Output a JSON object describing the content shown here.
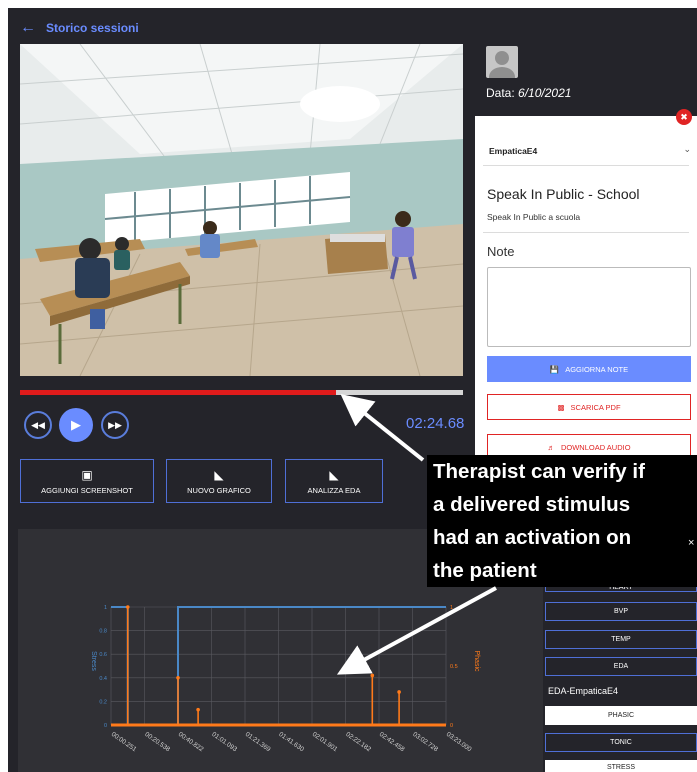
{
  "header": {
    "back_icon": "arrow-left-icon",
    "title": "Storico sessioni"
  },
  "player": {
    "progress_fraction": 0.714,
    "time": "02:24.68",
    "controls": [
      "rewind-icon",
      "play-icon",
      "fast-forward-icon"
    ]
  },
  "actions": [
    {
      "label": "AGGIUNGI SCREENSHOT",
      "icon": "camera-icon"
    },
    {
      "label": "NUOVO GRAFICO",
      "icon": "area-chart-icon"
    },
    {
      "label": "ANALIZZA EDA",
      "icon": "area-chart-icon"
    }
  ],
  "session": {
    "data_label": "Data:",
    "date": "6/10/2021",
    "device": "EmpaticaE4",
    "title": "Speak In Public - School",
    "subtitle": "Speak In Public a scuola",
    "note_label": "Note",
    "note_value": "",
    "buttons": {
      "update": "AGGIORNA NOTE",
      "pdf": "SCARICA PDF",
      "audio": "DOWNLOAD AUDIO"
    }
  },
  "metrics": {
    "buttons": [
      "HEART",
      "BVP",
      "TEMP",
      "EDA"
    ],
    "section_label": "EDA-EmpaticaE4",
    "sub_buttons": [
      "PHASIC",
      "TONIC",
      "STRESS"
    ],
    "active": "PHASIC"
  },
  "callout": {
    "lines": [
      "Therapist can verify if",
      "a delivered stimulus",
      "had an activation on",
      "the patient"
    ],
    "close": "×"
  },
  "colors": {
    "accent": "#6a8cff",
    "stress": "#4a88c7",
    "phasic": "#ff7a1a",
    "danger": "#e02424"
  },
  "chart_data": {
    "type": "line",
    "x_ticks": [
      "00:00.251",
      "00:20.538",
      "00:40.822",
      "01:01.093",
      "01:21.369",
      "01:41.630",
      "02:01.901",
      "02:22.182",
      "02:42.458",
      "03:02.728",
      "03:23.000"
    ],
    "y_left": {
      "label": "Stress",
      "ticks": [
        "0",
        "0.2",
        "0.4",
        "0.6",
        "0.8",
        "1"
      ],
      "range": [
        0,
        1
      ]
    },
    "y_right": {
      "label": "Phasic",
      "ticks": [
        "0",
        "0.5",
        "1"
      ],
      "range": [
        0,
        1
      ]
    },
    "series": [
      {
        "name": "Stress",
        "axis": "left",
        "x": [
          0,
          0.05,
          0.05,
          0.2,
          0.2,
          0.7,
          0.7,
          1.0
        ],
        "y": [
          1,
          1,
          0,
          0,
          1,
          1,
          1,
          1
        ]
      },
      {
        "name": "Phasic",
        "axis": "right",
        "baseline": 0,
        "spikes": [
          [
            0.05,
            1.0
          ],
          [
            0.2,
            0.4
          ],
          [
            0.26,
            0.13
          ],
          [
            0.78,
            0.42
          ],
          [
            0.86,
            0.28
          ]
        ]
      }
    ]
  }
}
